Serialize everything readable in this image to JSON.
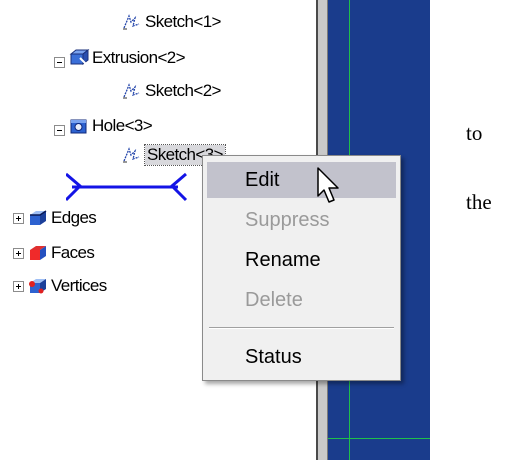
{
  "tree": {
    "items": [
      {
        "label": "Sketch<1>",
        "icon": "sketch-icon"
      },
      {
        "label": "Extrusion<2>",
        "icon": "extrusion-icon",
        "expander": "minus"
      },
      {
        "label": "Sketch<2>",
        "icon": "sketch-icon"
      },
      {
        "label": "Hole<3>",
        "icon": "hole-icon",
        "expander": "minus"
      },
      {
        "label": "Sketch<3>",
        "icon": "sketch-icon",
        "selected": true
      },
      {
        "label": "Edges",
        "icon": "edges-icon",
        "expander": "plus"
      },
      {
        "label": "Faces",
        "icon": "faces-icon",
        "expander": "plus"
      },
      {
        "label": "Vertices",
        "icon": "vertices-icon",
        "expander": "plus"
      }
    ]
  },
  "context_menu": {
    "items": [
      {
        "label": "Edit",
        "enabled": true,
        "highlighted": true
      },
      {
        "label": "Suppress",
        "enabled": false
      },
      {
        "label": "Rename",
        "enabled": true
      },
      {
        "label": "Delete",
        "enabled": false
      },
      {
        "label": "Status",
        "enabled": true
      }
    ]
  },
  "side_text": {
    "word1": "to",
    "word2": "the"
  },
  "colors": {
    "viewport": "#1a3c8c",
    "menu_highlight": "#c2c2cc",
    "gridline": "#1fbf4a"
  }
}
